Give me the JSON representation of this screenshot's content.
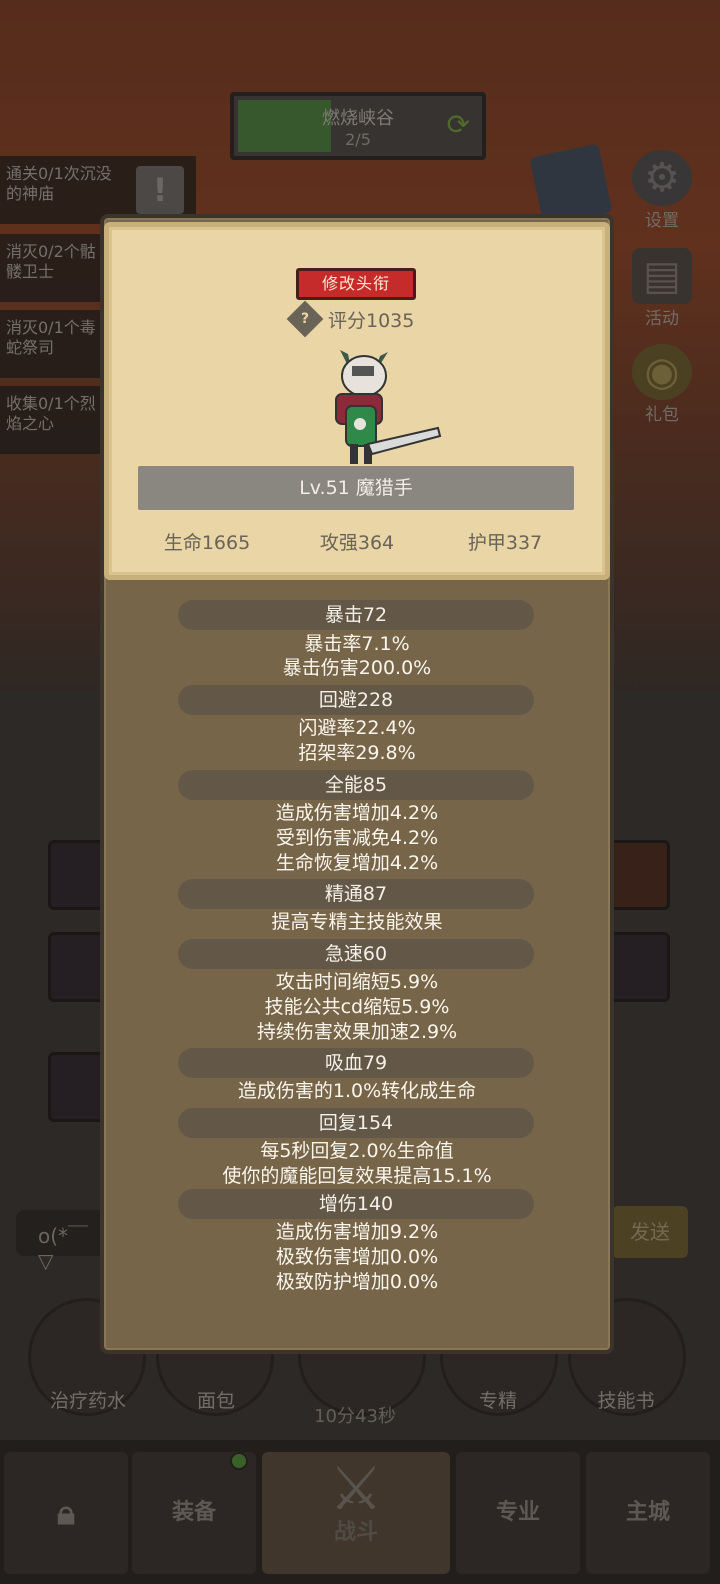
{
  "stage": {
    "name": "燃烧峡谷",
    "progress": "2/5",
    "progress_value": 0.4
  },
  "quests": [
    {
      "text": "通关0/1次沉没的神庙"
    },
    {
      "text": "消灭0/2个骷髅卫士"
    },
    {
      "text": "消灭0/1个毒蛇祭司"
    },
    {
      "text": "收集0/1个烈焰之心"
    }
  ],
  "side_buttons": [
    {
      "label": "设置",
      "icon": "gear-icon"
    },
    {
      "label": "活动",
      "icon": "scroll-icon"
    },
    {
      "label": "礼包",
      "icon": "gift-icon"
    }
  ],
  "panel": {
    "title_button": "修改头衔",
    "score": "评分1035",
    "character_name": "Lv.51 魔猎手",
    "basic_stats": [
      "生命1665",
      "攻强364",
      "护甲337"
    ],
    "groups": [
      {
        "header": "暴击72",
        "lines": [
          "暴击率7.1%",
          "暴击伤害200.0%"
        ]
      },
      {
        "header": "回避228",
        "lines": [
          "闪避率22.4%",
          "招架率29.8%"
        ]
      },
      {
        "header": "全能85",
        "lines": [
          "造成伤害增加4.2%",
          "受到伤害减免4.2%",
          "生命恢复增加4.2%"
        ]
      },
      {
        "header": "精通87",
        "lines": [
          "提高专精主技能效果"
        ]
      },
      {
        "header": "急速60",
        "lines": [
          "攻击时间缩短5.9%",
          "技能公共cd缩短5.9%",
          "持续伤害效果加速2.9%"
        ]
      },
      {
        "header": "吸血79",
        "lines": [
          "造成伤害的1.0%转化成生命"
        ]
      },
      {
        "header": "回复154",
        "lines": [
          "每5秒回复2.0%生命值",
          "使你的魔能回复效果提高15.1%"
        ]
      },
      {
        "header": "增伤140",
        "lines": [
          "造成伤害增加9.2%",
          "极致伤害增加0.0%",
          "极致防护增加0.0%"
        ]
      }
    ]
  },
  "chat": {
    "input_text": "o(*￣▽",
    "send_label": "发送"
  },
  "bottom_items": [
    "治疗药水",
    "面包",
    "专精",
    "技能书"
  ],
  "timer": "10分43秒",
  "nav": {
    "tabs": [
      "装备",
      "战斗",
      "专业",
      "主城"
    ]
  }
}
